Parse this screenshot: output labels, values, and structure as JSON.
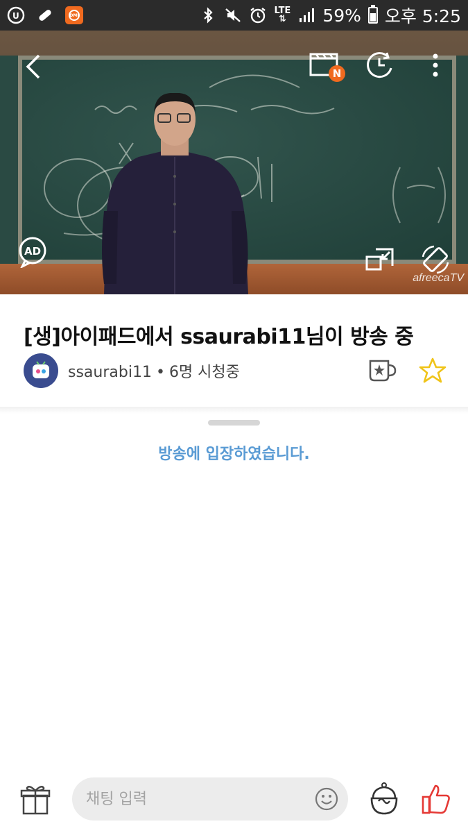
{
  "status_bar": {
    "battery_percent": "59%",
    "time": "오후 5:25",
    "network": "LTE",
    "battery_level": 0.59,
    "notification_icons": [
      "u-plus-icon",
      "pill-icon",
      "dmi-app-icon"
    ],
    "system_icons": [
      "bluetooth-icon",
      "mute-icon",
      "alarm-icon",
      "lte-icon",
      "signal-icon",
      "battery-icon"
    ]
  },
  "player": {
    "new_badge": "N",
    "ad_label": "AD",
    "watermark": "afreecaTV",
    "controls": [
      "back-icon",
      "clapperboard-icon",
      "timer-icon",
      "more-icon",
      "ad-icon",
      "pip-icon",
      "rotate-icon"
    ]
  },
  "broadcast": {
    "title": "[생]아이패드에서 ssaurabi11님이 방송 중",
    "broadcaster": "ssaurabi11",
    "separator": "•",
    "viewers": "6명 시청중",
    "accent_color": "#f0c419"
  },
  "chat": {
    "system_message": "방송에 입장하였습니다.",
    "system_message_color": "#5a9bd4",
    "input_placeholder": "채팅 입력",
    "input_value": ""
  },
  "bottom_bar": {
    "icons": [
      "gift-icon",
      "emoji-icon",
      "star-balloon-icon",
      "thumbs-up-icon"
    ],
    "like_color": "#e53935"
  }
}
